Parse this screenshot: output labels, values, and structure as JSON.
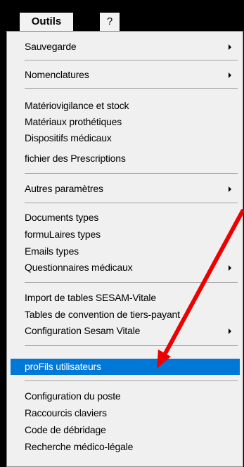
{
  "menubar": {
    "outils_label": "Outils",
    "help_label": "?"
  },
  "menu": {
    "items": [
      {
        "label": "Sauvegarde",
        "submenu": true
      },
      {
        "label": "Nomenclatures",
        "submenu": true
      },
      {
        "label": "Matériovigilance et stock",
        "submenu": false
      },
      {
        "label": "Matériaux prothétiques",
        "submenu": false
      },
      {
        "label": "Dispositifs médicaux",
        "submenu": false
      },
      {
        "label": "fichier des Prescriptions",
        "submenu": false
      },
      {
        "label": "Autres paramètres",
        "submenu": true
      },
      {
        "label": "Documents types",
        "submenu": false
      },
      {
        "label": "formuLaires types",
        "submenu": false
      },
      {
        "label": "Emails types",
        "submenu": false
      },
      {
        "label": "Questionnaires médicaux",
        "submenu": true
      },
      {
        "label": "Import de tables SESAM-Vitale",
        "submenu": false
      },
      {
        "label": "Tables de convention de tiers-payant",
        "submenu": false
      },
      {
        "label": "Configuration Sesam Vitale",
        "submenu": true
      },
      {
        "label": "proFils utilisateurs",
        "submenu": false,
        "selected": true
      },
      {
        "label": "Configuration du poste",
        "submenu": false
      },
      {
        "label": "Raccourcis claviers",
        "submenu": false
      },
      {
        "label": "Code de débridage",
        "submenu": false
      },
      {
        "label": "Recherche médico-légale",
        "submenu": false
      }
    ]
  },
  "colors": {
    "selection": "#0078d7",
    "annotation_arrow": "#ee0000"
  }
}
